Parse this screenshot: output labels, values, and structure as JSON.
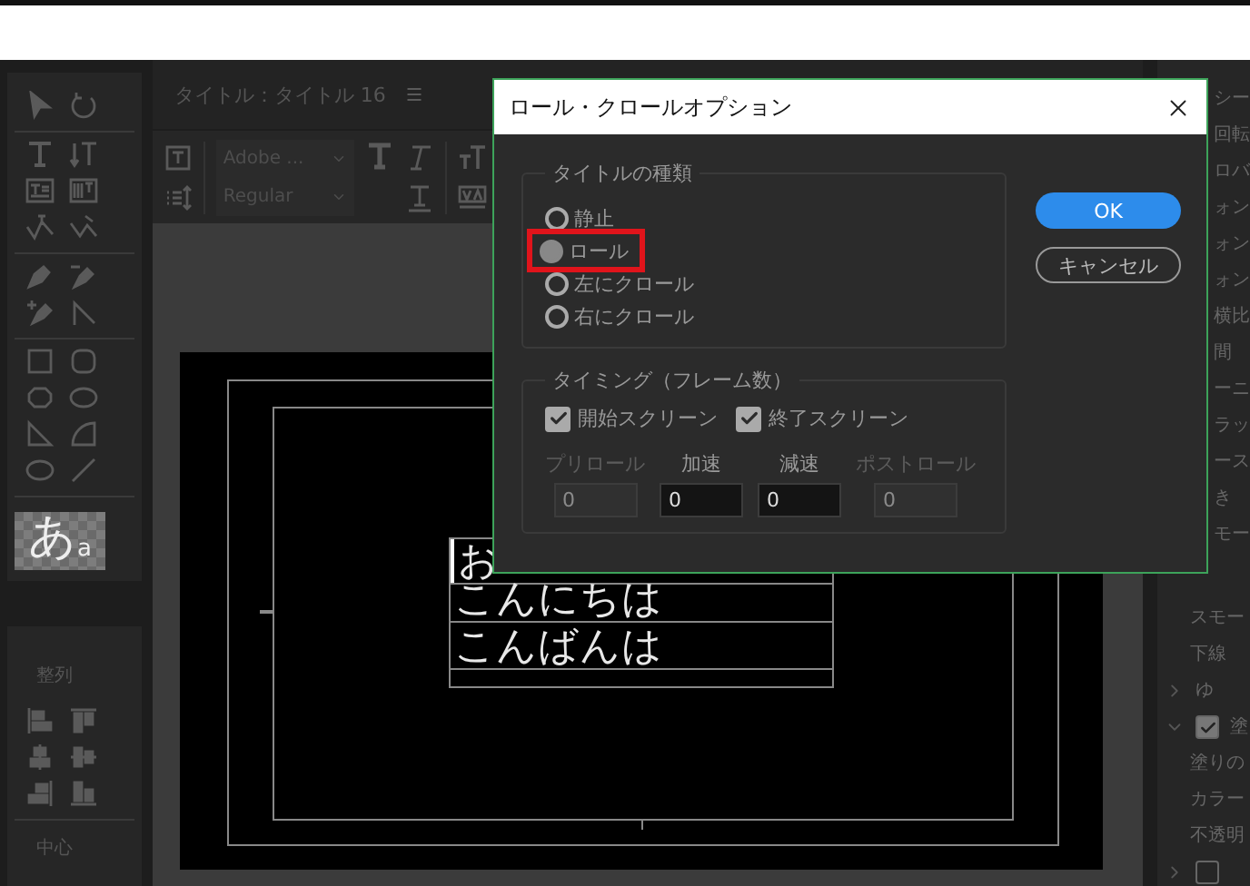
{
  "tools_panel": {
    "swatch_text": "あ",
    "swatch_subtext": "a"
  },
  "align_panel": {
    "label": "整列",
    "center_label": "中心"
  },
  "title_panel": {
    "title": "タイトル：タイトル 16",
    "font_family": "Adobe ...",
    "font_style": "Regular"
  },
  "canvas": {
    "lines": [
      "お",
      "こんにちは",
      "こんばんは"
    ]
  },
  "right_panel": {
    "upper_items": [
      "シー",
      "回転",
      "ロバ",
      "ォン",
      "ォン",
      "ォン",
      "横比",
      "間",
      "ーニ",
      "ラッ",
      "ース",
      "き",
      "モー"
    ],
    "lower_items": [
      {
        "kind": "text",
        "label": "スモー"
      },
      {
        "kind": "text",
        "label": "下線"
      },
      {
        "kind": "expander",
        "label": "ゆ",
        "expanded": false
      },
      {
        "kind": "check-group",
        "label": "塗",
        "expanded": true,
        "checked": true
      },
      {
        "kind": "text",
        "label": "塗りの"
      },
      {
        "kind": "text",
        "label": "カラー"
      },
      {
        "kind": "text",
        "label": "不透明"
      },
      {
        "kind": "check-group",
        "expanded": false,
        "checked": false
      }
    ]
  },
  "dialog": {
    "title": "ロール・クロールオプション",
    "type_group": {
      "label": "タイトルの種類",
      "options": [
        {
          "label": "静止",
          "selected": false,
          "highlighted": false
        },
        {
          "label": "ロール",
          "selected": true,
          "highlighted": true
        },
        {
          "label": "左にクロール",
          "selected": false,
          "highlighted": false
        },
        {
          "label": "右にクロール",
          "selected": false,
          "highlighted": false
        }
      ]
    },
    "timing_group": {
      "label": "タイミング（フレーム数）",
      "checks": [
        {
          "label": "開始スクリーン",
          "checked": true
        },
        {
          "label": "終了スクリーン",
          "checked": true
        }
      ],
      "fields": [
        {
          "label": "プリロール",
          "value": "0",
          "disabled": true
        },
        {
          "label": "加速",
          "value": "0",
          "disabled": false
        },
        {
          "label": "減速",
          "value": "0",
          "disabled": false
        },
        {
          "label": "ポストロール",
          "value": "0",
          "disabled": true
        }
      ]
    },
    "buttons": [
      {
        "label": "OK",
        "kind": "primary"
      },
      {
        "label": "キャンセル",
        "kind": "secondary"
      }
    ]
  }
}
